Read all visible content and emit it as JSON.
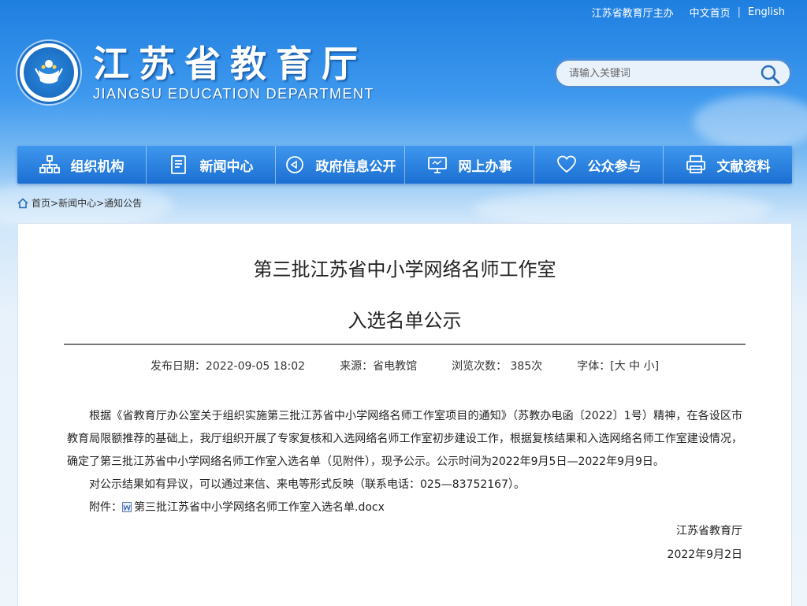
{
  "top_links": {
    "host": "江苏省教育厅主办",
    "cn_home": "中文首页",
    "english": "English"
  },
  "header": {
    "title_cn": "江苏省教育厅",
    "title_en": "JIANGSU EDUCATION DEPARTMENT"
  },
  "search": {
    "placeholder": "请输入关键词"
  },
  "nav": [
    {
      "label": "组织机构",
      "icon": "org-chart-icon"
    },
    {
      "label": "新闻中心",
      "icon": "document-icon"
    },
    {
      "label": "政府信息公开",
      "icon": "megaphone-icon"
    },
    {
      "label": "网上办事",
      "icon": "monitor-icon"
    },
    {
      "label": "公众参与",
      "icon": "heart-icon"
    },
    {
      "label": "文献资料",
      "icon": "printer-icon"
    }
  ],
  "breadcrumb": {
    "home": "首页>",
    "news": "新闻中心>",
    "notice": "通知公告"
  },
  "article": {
    "title_line1": "第三批江苏省中小学网络名师工作室",
    "title_line2": "入选名单公示",
    "meta": {
      "date": "发布日期：2022-09-05 18:02",
      "source": "来源：省电教馆",
      "views": "浏览次数： 385次",
      "font_label": "字体：[",
      "font_large": "大",
      "font_medium": "中",
      "font_small": "小",
      "font_end": "]"
    },
    "para1": "根据《省教育厅办公室关于组织实施第三批江苏省中小学网络名师工作室项目的通知》（苏教办电函〔2022〕1号）精神，在各设区市教育局限额推荐的基础上，我厅组织开展了专家复核和入选网络名师工作室初步建设工作，根据复核结果和入选网络名师工作室建设情况，确定了第三批江苏省中小学网络名师工作室入选名单（见附件），现予公示。公示时间为2022年9月5日—2022年9月9日。",
    "para2": "对公示结果如有异议，可以通过来信、来电等形式反映（联系电话：025—83752167）。",
    "attach_label": "附件：",
    "attach_name": "第三批江苏省中小学网络名师工作室入选名单.docx",
    "sign_org": "江苏省教育厅",
    "sign_date": "2022年9月2日"
  },
  "colors": {
    "nav_top": "#3f97ee",
    "nav_bottom": "#1b6fd2",
    "bg_top": "#1f7fe0"
  }
}
